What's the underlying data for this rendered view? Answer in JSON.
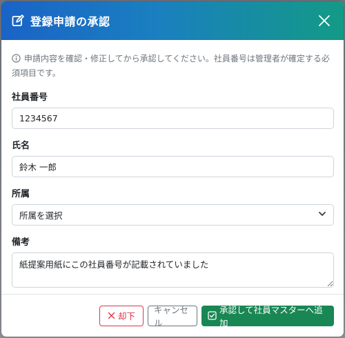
{
  "dialog": {
    "title": "登録申請の承認",
    "title_icon": "edit-icon",
    "close_icon": "close-icon"
  },
  "note": {
    "icon": "info-circle-icon",
    "text": "申請内容を確認・修正してから承認してください。社員番号は管理者が確定する必須項目です。"
  },
  "fields": {
    "employee_number": {
      "label": "社員番号",
      "value": "1234567"
    },
    "name": {
      "label": "氏名",
      "value": "鈴木 一郎"
    },
    "department": {
      "label": "所属",
      "selected": "所属を選択",
      "icon": "chevron-down-icon"
    },
    "remarks": {
      "label": "備考",
      "value": "紙提案用紙にこの社員番号が記載されていました"
    }
  },
  "footer": {
    "reject_label": "却下",
    "reject_icon": "x-icon",
    "cancel_label": "キャンセル",
    "approve_label": "承認して社員マスターへ追加",
    "approve_icon": "check-square-icon"
  },
  "colors": {
    "header_gradient_start": "#1a63c6",
    "header_gradient_end": "#139a86",
    "danger": "#dc3545",
    "secondary": "#6c757d",
    "success": "#198754"
  }
}
